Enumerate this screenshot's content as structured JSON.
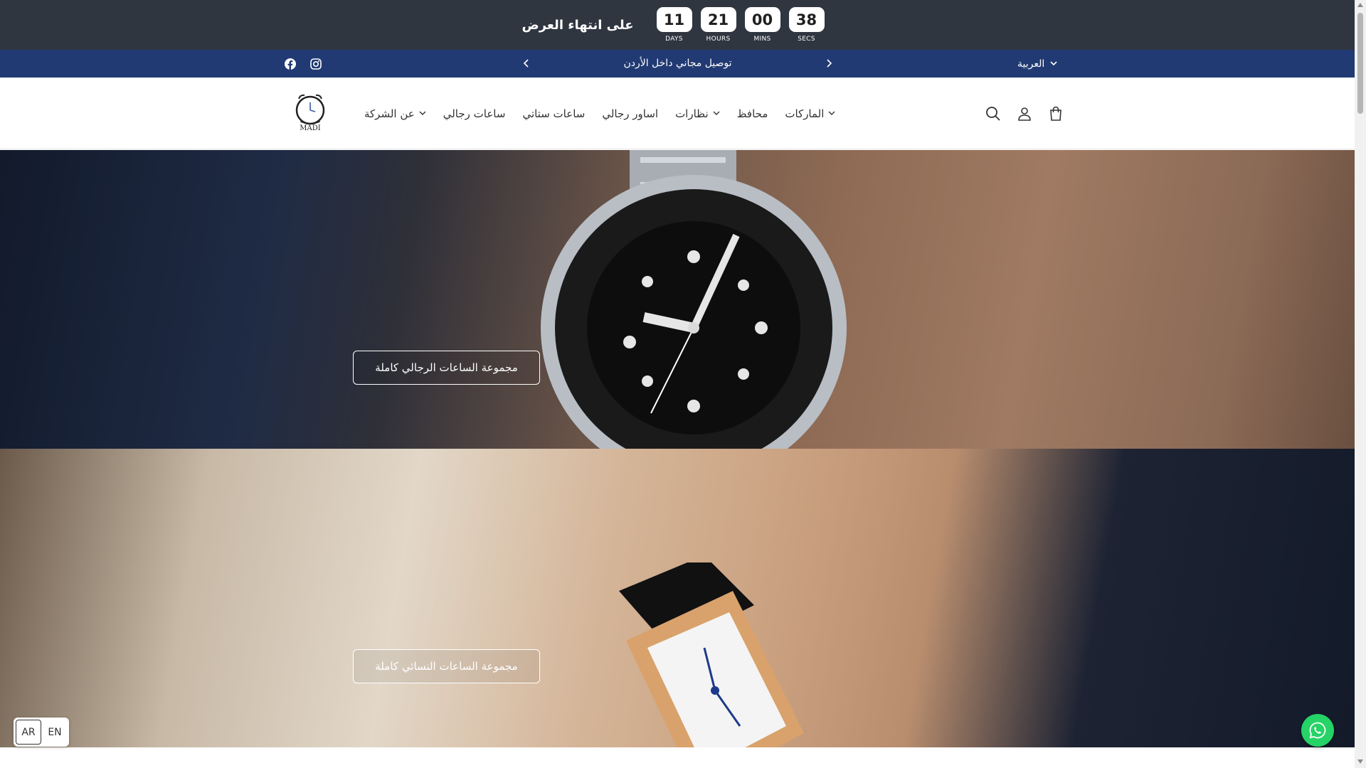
{
  "countdown": {
    "title": "على انتهاء العرض",
    "units": [
      {
        "value": "11",
        "label": "DAYS"
      },
      {
        "value": "21",
        "label": "HOURS"
      },
      {
        "value": "00",
        "label": "MINS"
      },
      {
        "value": "38",
        "label": "SECS"
      }
    ]
  },
  "announcement": {
    "text": "توصيل مجاني داخل الأردن",
    "social": [
      "facebook-icon",
      "instagram-icon"
    ],
    "prev_icon": "chevron-left-icon",
    "next_icon": "chevron-right-icon",
    "language_selected": "العربية"
  },
  "header": {
    "logo_text": "MADI",
    "nav": [
      {
        "label": "عن الشركة",
        "dropdown": true
      },
      {
        "label": "ساعات رجالي",
        "dropdown": false
      },
      {
        "label": "ساعات ستاتي",
        "dropdown": false
      },
      {
        "label": "اساور رجالي",
        "dropdown": false
      },
      {
        "label": "نظارات",
        "dropdown": true
      },
      {
        "label": "محافظ",
        "dropdown": false
      },
      {
        "label": "الماركات",
        "dropdown": true
      }
    ],
    "icons": [
      "search-icon",
      "account-icon",
      "cart-icon"
    ]
  },
  "banners": [
    {
      "button_label": "مجموعة الساعات الرجالي كاملة"
    },
    {
      "button_label": "مجموعة الساعات النسائي كاملة"
    }
  ],
  "lang_switch": {
    "ar": "AR",
    "en": "EN",
    "active": "AR"
  },
  "colors": {
    "countdown_bg": "#2f3640",
    "announcement_bg": "#213a73",
    "whatsapp_green": "#25d366"
  }
}
